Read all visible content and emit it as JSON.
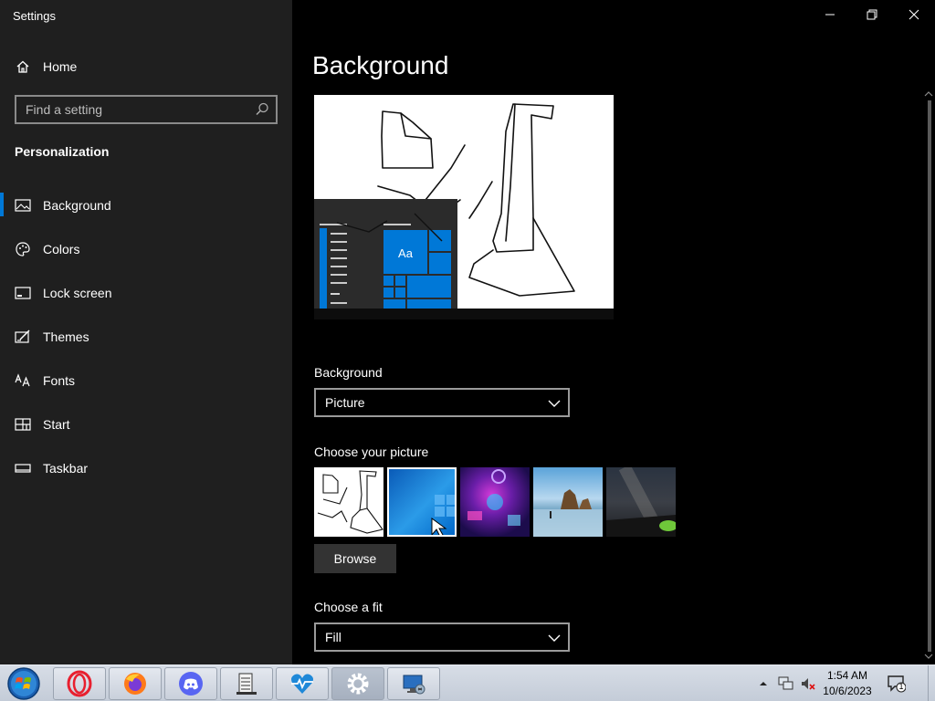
{
  "window": {
    "title": "Settings"
  },
  "sidebar": {
    "home_label": "Home",
    "search_placeholder": "Find a setting",
    "section_title": "Personalization",
    "items": [
      {
        "label": "Background",
        "icon": "picture-icon"
      },
      {
        "label": "Colors",
        "icon": "palette-icon"
      },
      {
        "label": "Lock screen",
        "icon": "lock-screen-icon"
      },
      {
        "label": "Themes",
        "icon": "themes-icon"
      },
      {
        "label": "Fonts",
        "icon": "fonts-icon"
      },
      {
        "label": "Start",
        "icon": "start-icon"
      },
      {
        "label": "Taskbar",
        "icon": "taskbar-icon"
      }
    ],
    "active_item": "Background"
  },
  "main": {
    "title": "Background",
    "preview": {
      "tile_text": "Aa"
    },
    "background_label": "Background",
    "background_value": "Picture",
    "choose_picture_label": "Choose your picture",
    "browse_label": "Browse",
    "choose_fit_label": "Choose a fit",
    "fit_value": "Fill"
  },
  "taskbar": {
    "apps": [
      "Opera",
      "Firefox",
      "Discord",
      "Notepad",
      "Health",
      "Settings",
      "Remote Desktop"
    ],
    "clock_time": "1:54 AM",
    "clock_date": "10/6/2023",
    "notification_count": "1"
  },
  "colors": {
    "accent": "#0078d7",
    "sidebar_bg": "#1f1f1f",
    "main_bg": "#000000"
  }
}
